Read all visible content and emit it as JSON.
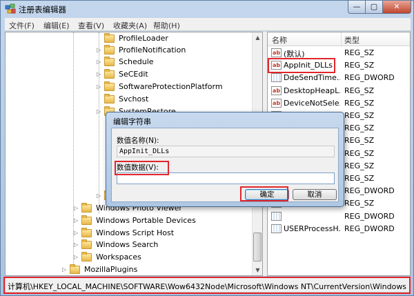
{
  "window": {
    "title": "注册表编辑器",
    "min": "—",
    "max": "▢",
    "close": "✕"
  },
  "menu": [
    "文件(F)",
    "编辑(E)",
    "查看(V)",
    "收藏夹(A)",
    "帮助(H)"
  ],
  "tree": {
    "upper": [
      "ProfileLoader",
      "ProfileNotification",
      "Schedule",
      "SeCEdit",
      "SoftwareProtectionPlatform",
      "Svchost",
      "SystemRestore"
    ],
    "lower": [
      "Windows Portable Devices",
      "Windows Script Host",
      "Windows Search",
      "Workspaces"
    ],
    "partial_lower": "Windows Photo Viewer",
    "bottom": "MozillaPlugins"
  },
  "list": {
    "headers": {
      "name": "名称",
      "type": "类型"
    },
    "rows": [
      {
        "name": "(默认)",
        "type": "REG_SZ",
        "kind": "sz"
      },
      {
        "name": "AppInit_DLLs",
        "type": "REG_SZ",
        "kind": "sz"
      },
      {
        "name": "DdeSendTime...",
        "type": "REG_DWORD",
        "kind": "dword"
      },
      {
        "name": "DesktopHeapL...",
        "type": "REG_SZ",
        "kind": "sz"
      },
      {
        "name": "DeviceNotSele...",
        "type": "REG_SZ",
        "kind": "sz"
      },
      {
        "name": "",
        "type": "REG_SZ",
        "kind": "sz"
      },
      {
        "name": "",
        "type": "REG_SZ",
        "kind": "sz"
      },
      {
        "name": "",
        "type": "REG_SZ",
        "kind": "sz"
      },
      {
        "name": "",
        "type": "REG_SZ",
        "kind": "sz"
      },
      {
        "name": "",
        "type": "REG_SZ",
        "kind": "sz"
      },
      {
        "name": "",
        "type": "REG_SZ",
        "kind": "sz"
      },
      {
        "name": "",
        "type": "REG_DWORD",
        "kind": "dword"
      },
      {
        "name": "",
        "type": "REG_SZ",
        "kind": "sz"
      },
      {
        "name": "",
        "type": "REG_DWORD",
        "kind": "dword"
      },
      {
        "name": "USERProcessH...",
        "type": "REG_DWORD",
        "kind": "dword"
      }
    ]
  },
  "status": {
    "path": "计算机\\HKEY_LOCAL_MACHINE\\SOFTWARE\\Wow6432Node\\Microsoft\\Windows NT\\CurrentVersion\\Windows"
  },
  "dialog": {
    "title": "编辑字符串",
    "name_label": "数值名称(N):",
    "name_value": "AppInit_DLLs",
    "data_label": "数值数据(V):",
    "data_value": "",
    "ok": "确定",
    "cancel": "取消"
  },
  "colors": {
    "highlight": "#e3242b",
    "sz_icon": "#c0392b",
    "dword_icon": "#1f5fbf"
  },
  "icons": {
    "app": "registry-editor-icon",
    "value_sz": "ab-string-icon",
    "value_dword": "binary-dword-icon",
    "folder": "folder-icon"
  }
}
